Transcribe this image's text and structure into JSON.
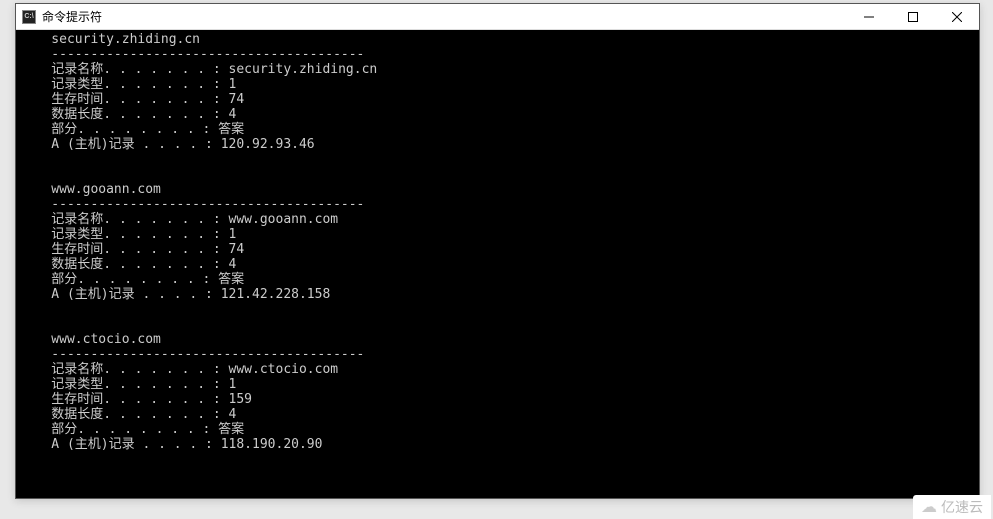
{
  "window": {
    "icon_label": "C:\\",
    "title": "命令提示符"
  },
  "terminal": {
    "blocks": [
      {
        "heading": "security.zhiding.cn",
        "divider": "----------------------------------------",
        "rows": [
          {
            "label": "记录名称",
            "dots": ". . . . . . . :",
            "value": "security.zhiding.cn"
          },
          {
            "label": "记录类型",
            "dots": ". . . . . . . :",
            "value": "1"
          },
          {
            "label": "生存时间",
            "dots": ". . . . . . . :",
            "value": "74"
          },
          {
            "label": "数据长度",
            "dots": ". . . . . . . :",
            "value": "4"
          },
          {
            "label": "部分",
            "dots": ". . . . . . . . :",
            "value": "答案"
          },
          {
            "label": "A (主机)记录",
            "dots": " . . . . :",
            "value": "120.92.93.46"
          }
        ]
      },
      {
        "heading": "www.gooann.com",
        "divider": "----------------------------------------",
        "rows": [
          {
            "label": "记录名称",
            "dots": ". . . . . . . :",
            "value": "www.gooann.com"
          },
          {
            "label": "记录类型",
            "dots": ". . . . . . . :",
            "value": "1"
          },
          {
            "label": "生存时间",
            "dots": ". . . . . . . :",
            "value": "74"
          },
          {
            "label": "数据长度",
            "dots": ". . . . . . . :",
            "value": "4"
          },
          {
            "label": "部分",
            "dots": ". . . . . . . . :",
            "value": "答案"
          },
          {
            "label": "A (主机)记录",
            "dots": " . . . . :",
            "value": "121.42.228.158"
          }
        ]
      },
      {
        "heading": "www.ctocio.com",
        "divider": "----------------------------------------",
        "rows": [
          {
            "label": "记录名称",
            "dots": ". . . . . . . :",
            "value": "www.ctocio.com"
          },
          {
            "label": "记录类型",
            "dots": ". . . . . . . :",
            "value": "1"
          },
          {
            "label": "生存时间",
            "dots": ". . . . . . . :",
            "value": "159"
          },
          {
            "label": "数据长度",
            "dots": ". . . . . . . :",
            "value": "4"
          },
          {
            "label": "部分",
            "dots": ". . . . . . . . :",
            "value": "答案"
          },
          {
            "label": "A (主机)记录",
            "dots": " . . . . :",
            "value": "118.190.20.90"
          }
        ]
      }
    ]
  },
  "watermark": {
    "text": "亿速云"
  }
}
